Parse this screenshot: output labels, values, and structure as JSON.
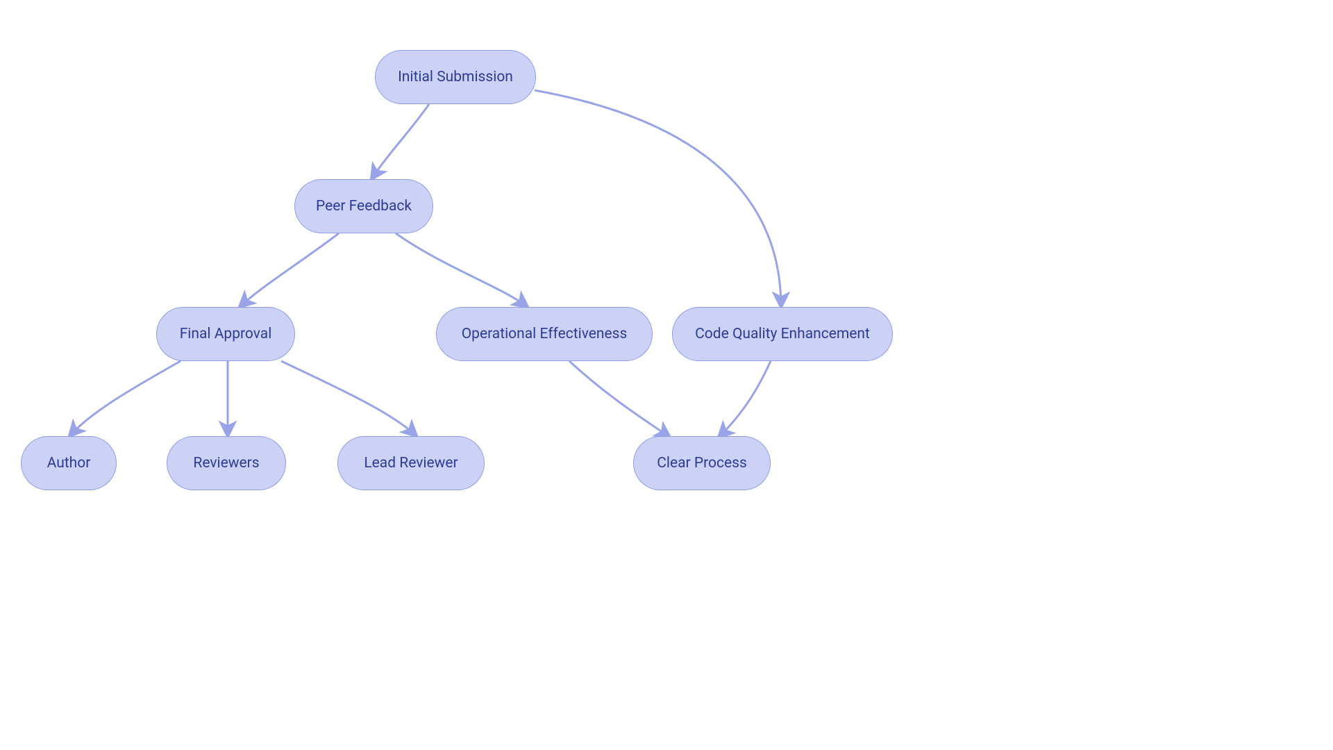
{
  "nodes": {
    "initial_submission": {
      "label": "Initial Submission"
    },
    "peer_feedback": {
      "label": "Peer Feedback"
    },
    "final_approval": {
      "label": "Final Approval"
    },
    "op_effectiveness": {
      "label": "Operational Effectiveness"
    },
    "code_quality": {
      "label": "Code Quality Enhancement"
    },
    "author": {
      "label": "Author"
    },
    "reviewers": {
      "label": "Reviewers"
    },
    "lead_reviewer": {
      "label": "Lead Reviewer"
    },
    "clear_process": {
      "label": "Clear Process"
    }
  },
  "edges": [
    {
      "from": "initial_submission",
      "to": "peer_feedback"
    },
    {
      "from": "initial_submission",
      "to": "code_quality"
    },
    {
      "from": "peer_feedback",
      "to": "final_approval"
    },
    {
      "from": "peer_feedback",
      "to": "op_effectiveness"
    },
    {
      "from": "final_approval",
      "to": "author"
    },
    {
      "from": "final_approval",
      "to": "reviewers"
    },
    {
      "from": "final_approval",
      "to": "lead_reviewer"
    },
    {
      "from": "op_effectiveness",
      "to": "clear_process"
    },
    {
      "from": "code_quality",
      "to": "clear_process"
    }
  ],
  "colors": {
    "node_fill": "#CBD2F6",
    "node_border": "#8C9AE8",
    "node_text": "#2D3B97",
    "edge": "#98A3E8"
  }
}
